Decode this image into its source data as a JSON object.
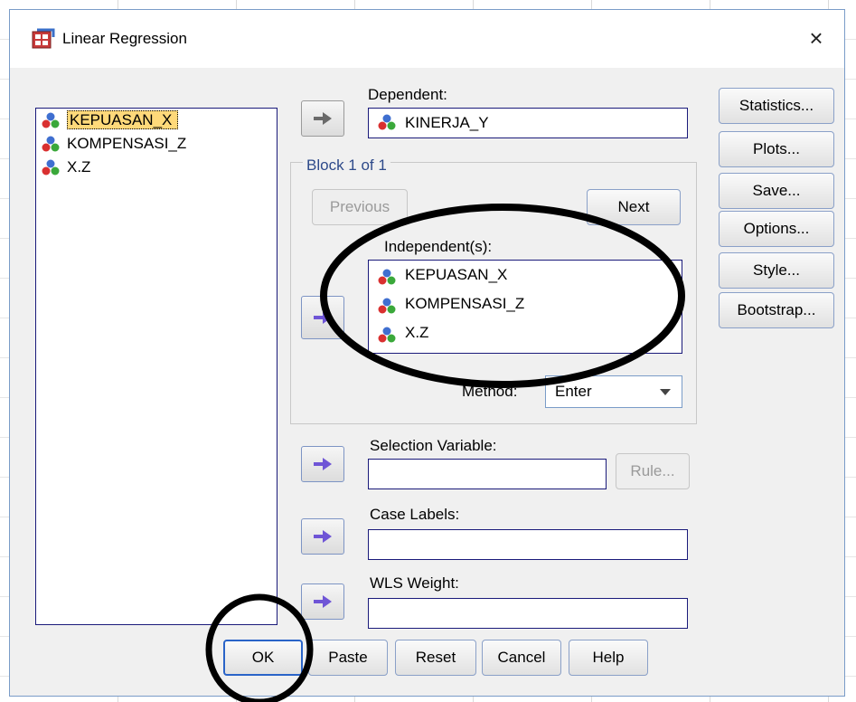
{
  "window": {
    "title": "Linear Regression",
    "close_symbol": "×"
  },
  "source_variables": [
    {
      "name": "KEPUASAN_X",
      "selected": true
    },
    {
      "name": "KOMPENSASI_Z",
      "selected": false
    },
    {
      "name": "X.Z",
      "selected": false
    }
  ],
  "dependent": {
    "label": "Dependent:",
    "value": "KINERJA_Y"
  },
  "block": {
    "title": "Block 1 of 1",
    "previous_label": "Previous",
    "next_label": "Next",
    "independent_label": "Independent(s):",
    "independents": [
      "KEPUASAN_X",
      "KOMPENSASI_Z",
      "X.Z"
    ],
    "method_label": "Method:",
    "method_value": "Enter"
  },
  "selection_variable": {
    "label": "Selection Variable:",
    "value": "",
    "rule_label": "Rule..."
  },
  "case_labels": {
    "label": "Case Labels:",
    "value": ""
  },
  "wls_weight": {
    "label": "WLS Weight:",
    "value": ""
  },
  "side_buttons": [
    "Statistics...",
    "Plots...",
    "Save...",
    "Options...",
    "Style...",
    "Bootstrap..."
  ],
  "bottom_buttons": {
    "ok": "OK",
    "paste": "Paste",
    "reset": "Reset",
    "cancel": "Cancel",
    "help": "Help"
  },
  "colors": {
    "dialog_bg": "#f0f0f0",
    "selection_highlight": "#ffd97a",
    "arrow_active": "#6f55d6",
    "annotation_ink": "#000000"
  }
}
